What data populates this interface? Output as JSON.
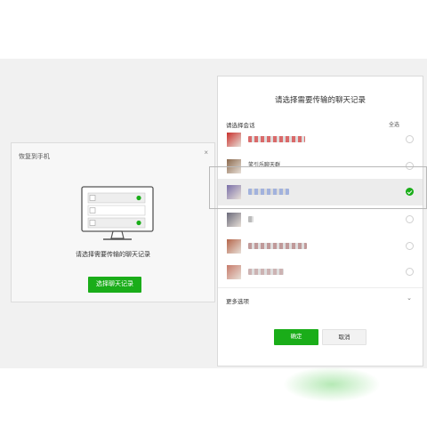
{
  "colors": {
    "accent": "#1aad19",
    "page_background": "#f1f1f1",
    "dialog_border": "#dadada"
  },
  "left_dialog": {
    "title": "恢复到手机",
    "close_icon": "×",
    "description": "请选择需要传输的聊天记录",
    "select_button_label": "选择聊天记录"
  },
  "right_dialog": {
    "title": "请选择需要传输的聊天记录",
    "section_label": "请选择会话",
    "select_all_label": "全选",
    "chats": [
      {
        "name": "",
        "checked": false,
        "avatar_color": "#c9302c",
        "name_color": "#d04545"
      },
      {
        "name": "笑引乐聊天群",
        "checked": false,
        "avatar_color": "#8b6a4e",
        "name_color": "#555555"
      },
      {
        "name": "",
        "checked": true,
        "avatar_color": "#7a6fa8",
        "name_color": "#8fa4d9"
      },
      {
        "name": "",
        "checked": false,
        "avatar_color": "#6a6a7a",
        "name_color": "#aaaaaa"
      },
      {
        "name": "",
        "checked": false,
        "avatar_color": "#b5654a",
        "name_color": "#b08080"
      },
      {
        "name": "",
        "checked": false,
        "avatar_color": "#c77a6a",
        "name_color": "#c0a0a0"
      }
    ],
    "more_options_label": "更多选项",
    "more_chevron": "⌄",
    "confirm_label": "确定",
    "cancel_label": "取消"
  }
}
